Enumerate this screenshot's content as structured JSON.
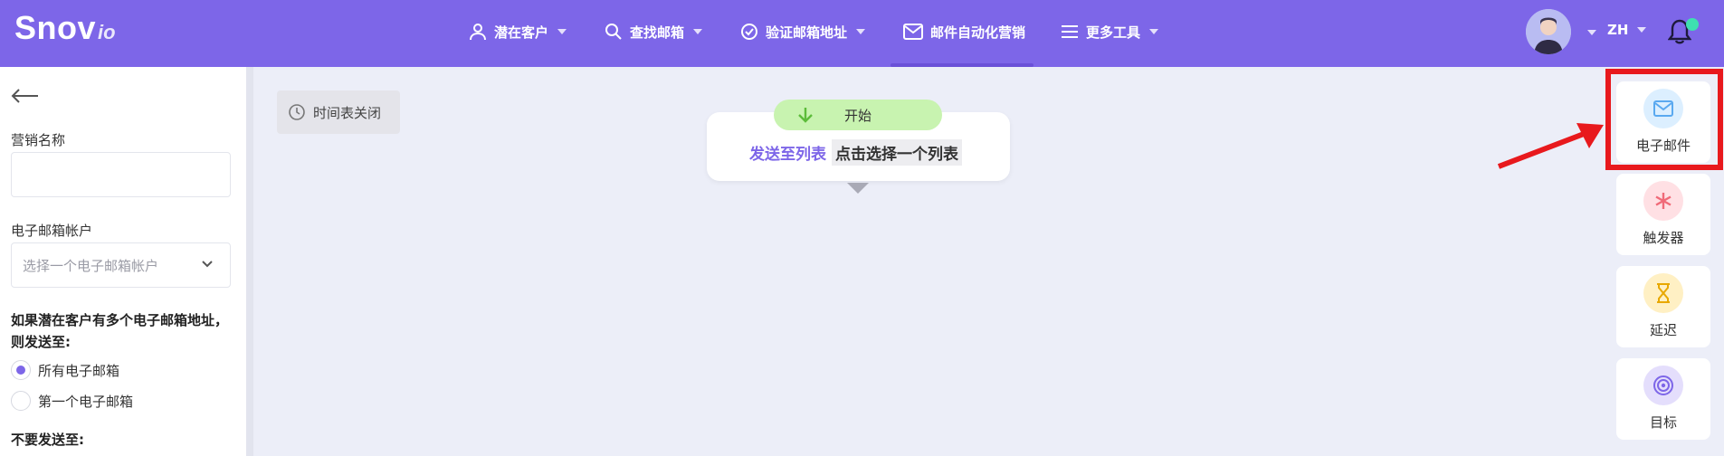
{
  "logo": {
    "main": "Snov",
    "sub": "io"
  },
  "nav": {
    "items": [
      {
        "label": "潜在客户",
        "icon": "user-icon"
      },
      {
        "label": "查找邮箱",
        "icon": "search-icon"
      },
      {
        "label": "验证邮箱地址",
        "icon": "check-circle-icon"
      },
      {
        "label": "邮件自动化营销",
        "icon": "envelope-icon"
      },
      {
        "label": "更多工具",
        "icon": "menu-icon"
      }
    ],
    "lang": "ZH"
  },
  "left_panel": {
    "campaign_name_label": "营销名称",
    "campaign_name_value": "",
    "email_account_label": "电子邮箱帐户",
    "email_account_placeholder": "选择一个电子邮箱帐户",
    "multi_email_label": "如果潜在客户有多个电子邮箱地址，则发送至:",
    "radio_all": "所有电子邮箱",
    "radio_first": "第一个电子邮箱",
    "do_not_send_label": "不要发送至:"
  },
  "canvas": {
    "schedule_label": "时间表关闭",
    "start_label": "开始",
    "send_to_label": "发送至列表",
    "choose_list_label": "点击选择一个列表"
  },
  "tools": [
    {
      "label": "电子邮件",
      "icon": "envelope-icon",
      "color": "#5aa9f0",
      "bg": "#dcefff"
    },
    {
      "label": "触发器",
      "icon": "asterisk-icon",
      "color": "#f06a78",
      "bg": "#ffe0e4"
    },
    {
      "label": "延迟",
      "icon": "hourglass-icon",
      "color": "#e8a800",
      "bg": "#fff0c4"
    },
    {
      "label": "目标",
      "icon": "target-icon",
      "color": "#7d66e8",
      "bg": "#e4defc"
    }
  ],
  "colors": {
    "brand": "#7d66e8",
    "annotation": "#e8191d"
  }
}
